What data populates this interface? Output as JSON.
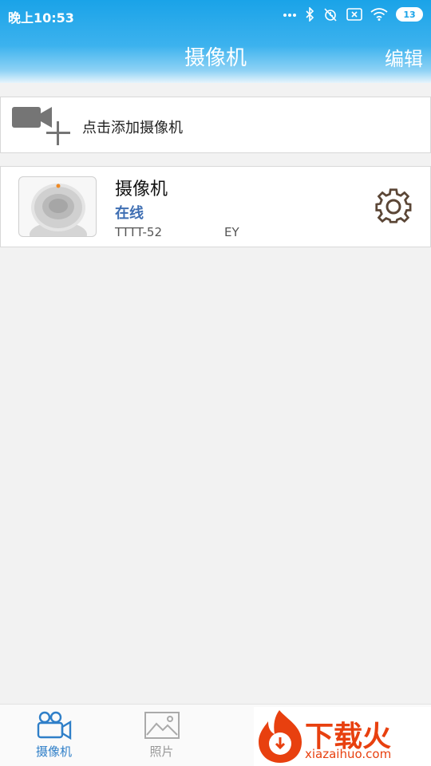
{
  "status_bar": {
    "time": "晚上10:53",
    "battery": "13"
  },
  "header": {
    "title": "摄像机",
    "edit_label": "编辑"
  },
  "add_camera": {
    "label": "点击添加摄像机"
  },
  "camera": {
    "name": "摄像机",
    "status": "在线",
    "id_prefix": "TTTT-52",
    "id_suffix": "EY"
  },
  "tabs": [
    {
      "label": "摄像机",
      "icon": "camera-icon",
      "active": true
    },
    {
      "label": "照片",
      "icon": "picture-icon",
      "active": false
    }
  ],
  "watermark": {
    "title": "下载火",
    "url": "xiazaihuo.com"
  },
  "colors": {
    "header": "#1aa3e8",
    "accent": "#2f7fc8",
    "online": "#3f6fb3",
    "watermark": "#e8400f"
  }
}
